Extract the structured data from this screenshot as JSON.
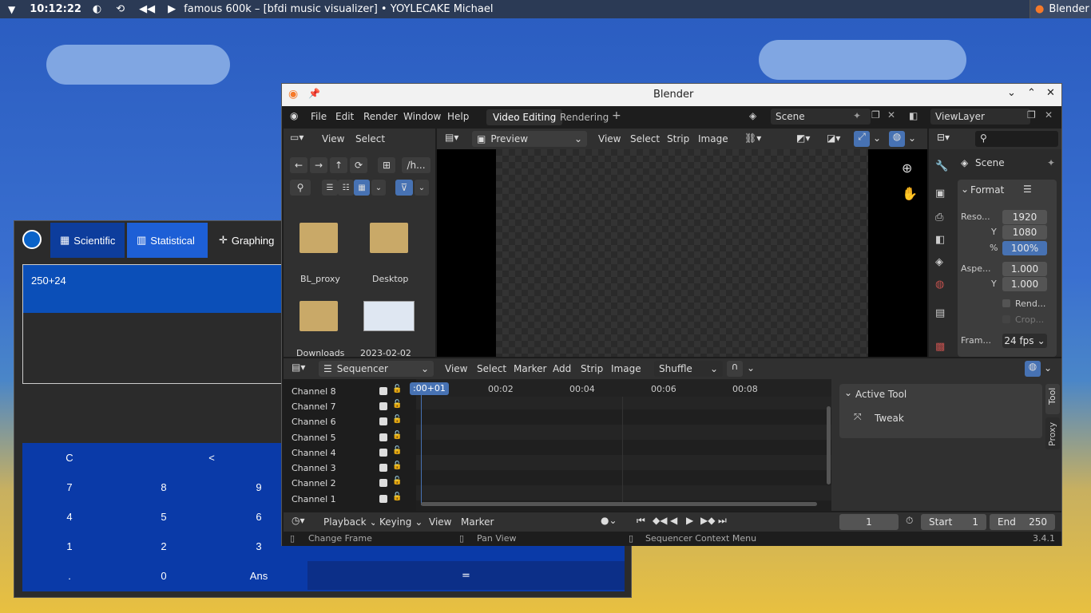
{
  "taskbar": {
    "time": "10:12:22",
    "media_title": "famous 600k – [bfdi music visualizer] • YOYLECAKE Michael",
    "active_app": "Blender"
  },
  "calculator": {
    "tabs": [
      "Scientific",
      "Statistical",
      "Graphing"
    ],
    "expression": "250+24",
    "keys": {
      "clear": "C",
      "back": "<",
      "k7": "7",
      "k8": "8",
      "k9": "9",
      "k4": "4",
      "k5": "5",
      "k6": "6",
      "k1": "1",
      "k2": "2",
      "k3": "3",
      "dot": ".",
      "k0": "0",
      "ans": "Ans",
      "eq": "="
    },
    "colors": {
      "accent": "#0a3aa8",
      "active_tab": "#1d5fd6",
      "display": "#0b4fb8"
    }
  },
  "blender": {
    "window_title": "Blender",
    "menu": [
      "File",
      "Edit",
      "Render",
      "Window",
      "Help"
    ],
    "workspaces": [
      "Video Editing",
      "Rendering"
    ],
    "scene": "Scene",
    "view_layer": "ViewLayer",
    "filebrowser": {
      "menu": [
        "View",
        "Select"
      ],
      "path": "/h...",
      "items": [
        "BL_proxy",
        "Desktop",
        "Downloads",
        "2023-02-02"
      ]
    },
    "preview": {
      "mode": "Preview",
      "menu": [
        "View",
        "Select",
        "Strip",
        "Image"
      ]
    },
    "properties": {
      "scene_label": "Scene",
      "format_label": "Format",
      "res_label": "Reso...",
      "res_x": "1920",
      "y_label": "Y",
      "res_y": "1080",
      "pct_label": "%",
      "res_pct": "100%",
      "aspect_label": "Aspe...",
      "aspect_x": "1.000",
      "aspect_y": "1.000",
      "render_region": "Rend...",
      "crop": "Crop...",
      "frame_label": "Fram...",
      "fps": "24 fps"
    },
    "sequencer": {
      "mode": "Sequencer",
      "menu": [
        "View",
        "Select",
        "Marker",
        "Add",
        "Strip",
        "Image"
      ],
      "overlap": "Shuffle",
      "current_time": ":00+01",
      "ticks": [
        "00:02",
        "00:04",
        "00:06",
        "00:08"
      ],
      "channels": [
        "Channel 8",
        "Channel 7",
        "Channel 6",
        "Channel 5",
        "Channel 4",
        "Channel 3",
        "Channel 2",
        "Channel 1"
      ],
      "active_tool_label": "Active Tool",
      "tool": "Tweak",
      "side_tabs": [
        "Tool",
        "Proxy"
      ]
    },
    "timeline": {
      "playback": "Playback",
      "keying": "Keying",
      "view": "View",
      "marker": "Marker",
      "frame": "1",
      "start_label": "Start",
      "start": "1",
      "end_label": "End",
      "end": "250"
    },
    "status": {
      "left": "Change Frame",
      "middle": "Pan View",
      "right": "Sequencer Context Menu",
      "version": "3.4.1"
    }
  }
}
